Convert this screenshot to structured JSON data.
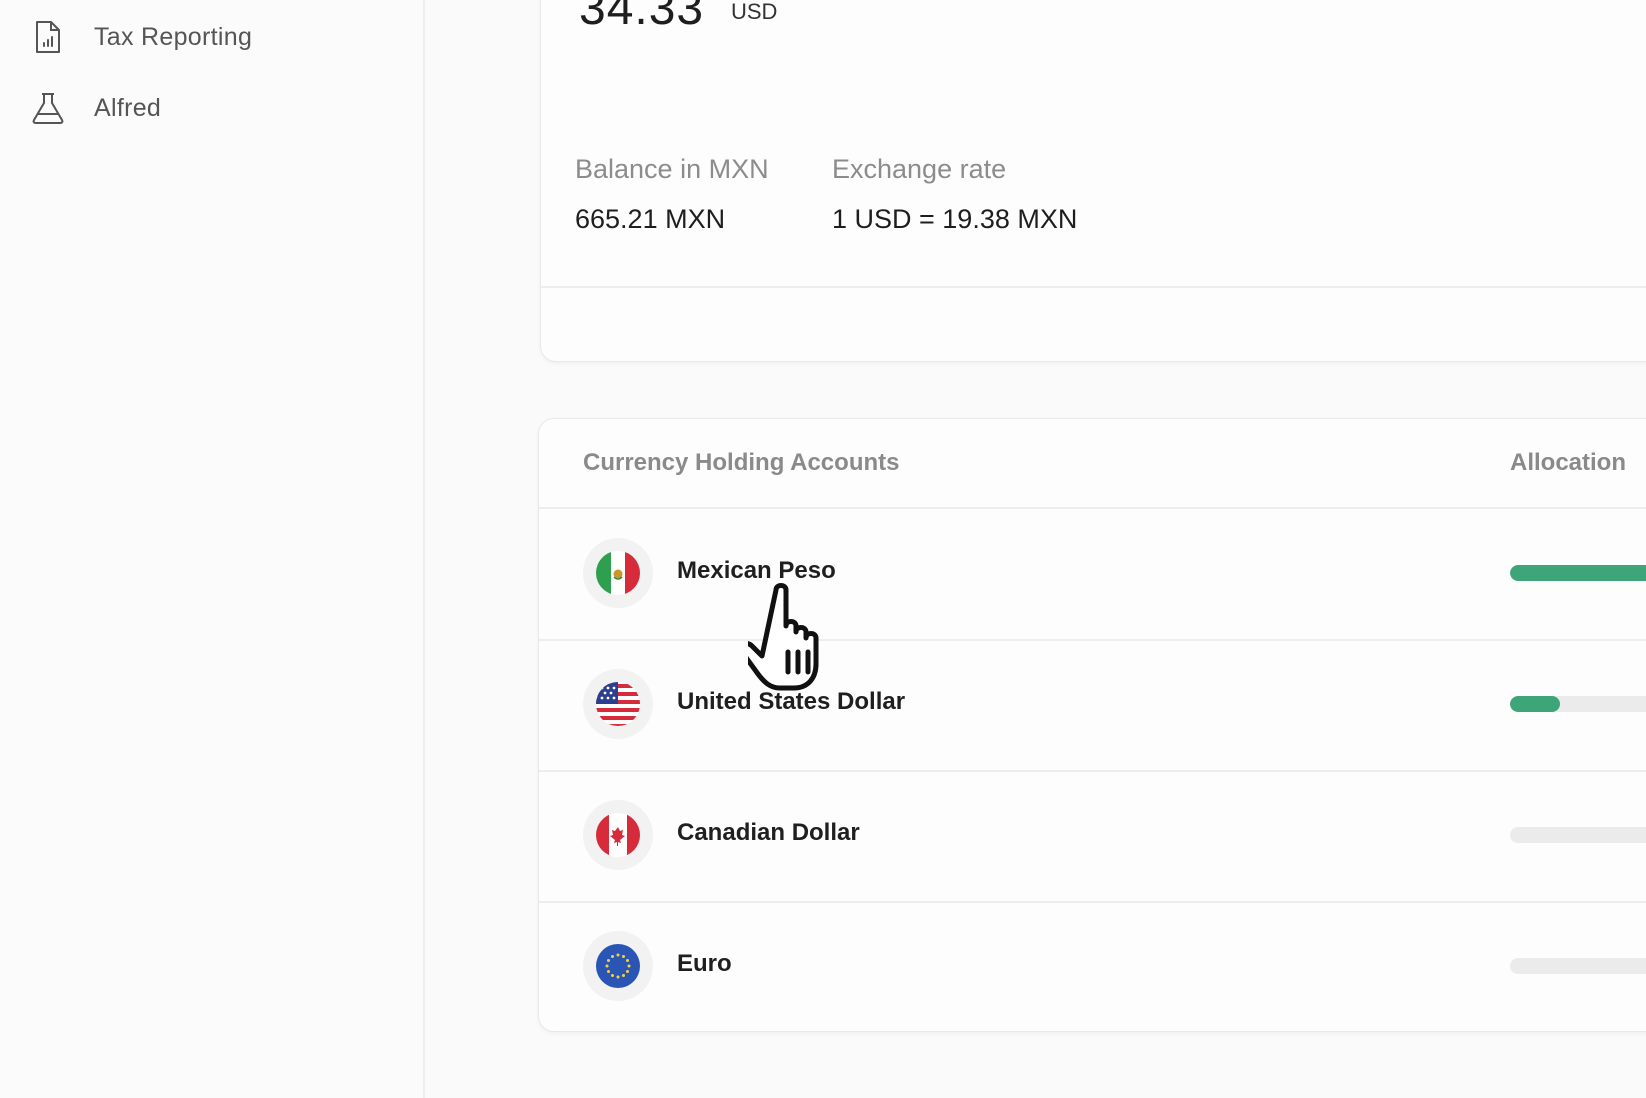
{
  "sidebar": {
    "items": [
      {
        "label": "Tax Reporting",
        "icon": "document-chart-icon"
      },
      {
        "label": "Alfred",
        "icon": "flask-icon"
      }
    ]
  },
  "balance": {
    "amount": "34.33",
    "currency": "USD",
    "balance_label": "Balance in MXN",
    "balance_value": "665.21 MXN",
    "rate_label": "Exchange rate",
    "rate_value": "1 USD = 19.38 MXN"
  },
  "holdings": {
    "title": "Currency Holding Accounts",
    "allocation_label": "Allocation",
    "rows": [
      {
        "name": "Mexican Peso",
        "flag": "mexico-flag-icon",
        "allocation_pct": 100
      },
      {
        "name": "United States Dollar",
        "flag": "us-flag-icon",
        "allocation_pct": 25
      },
      {
        "name": "Canadian Dollar",
        "flag": "canada-flag-icon",
        "allocation_pct": 0
      },
      {
        "name": "Euro",
        "flag": "eu-flag-icon",
        "allocation_pct": 0
      }
    ]
  },
  "colors": {
    "accent": "#3ea578",
    "track": "#ebebeb",
    "muted_text": "#8a8a8a"
  }
}
